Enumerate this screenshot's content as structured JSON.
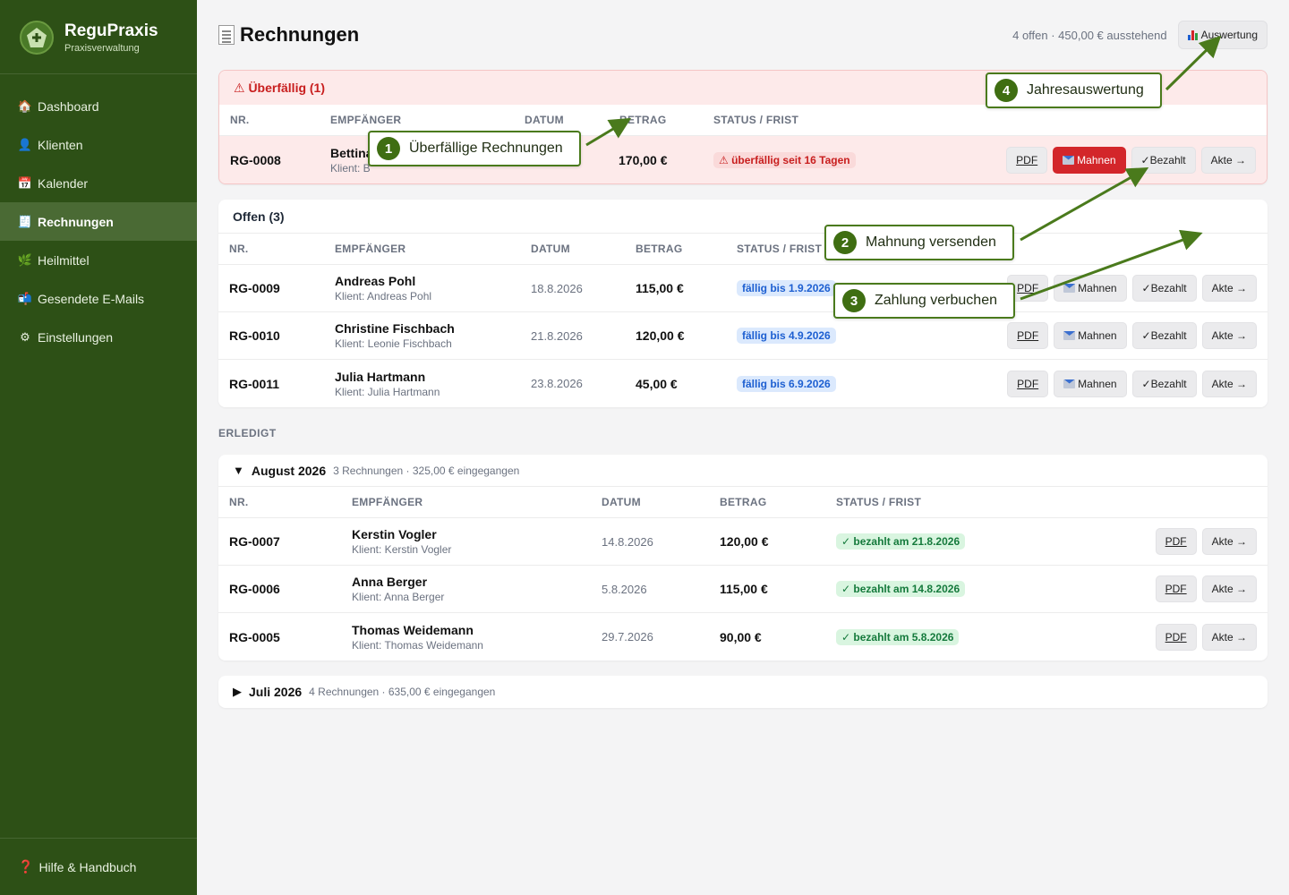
{
  "brand": {
    "title": "ReguPraxis",
    "subtitle": "Praxisverwaltung"
  },
  "sidebar": {
    "items": [
      {
        "label": "Dashboard",
        "icon": "house-icon"
      },
      {
        "label": "Klienten",
        "icon": "person-icon"
      },
      {
        "label": "Kalender",
        "icon": "calendar-icon"
      },
      {
        "label": "Rechnungen",
        "icon": "receipt-icon",
        "active": true
      },
      {
        "label": "Heilmittel",
        "icon": "herb-icon"
      },
      {
        "label": "Gesendete E-Mails",
        "icon": "mailbox-icon"
      },
      {
        "label": "Einstellungen",
        "icon": "gear-icon"
      }
    ],
    "footer": "Hilfe & Handbuch"
  },
  "header": {
    "title": "Rechnungen",
    "summary": "4 offen · 450,00 € ausstehend",
    "eval_button": "Auswertung"
  },
  "columns": {
    "nr": "NR.",
    "recipient": "EMPFÄNGER",
    "date": "DATUM",
    "amount": "BETRAG",
    "status": "STATUS / FRIST"
  },
  "buttons": {
    "pdf": "PDF",
    "remind": "Mahnen",
    "paid": "✓Bezahlt",
    "file": "Akte →"
  },
  "overdue": {
    "title": "⚠ Überfällig (1)",
    "rows": [
      {
        "nr": "RG-0008",
        "name": "Bettina",
        "client": "Klient: B",
        "date": "",
        "amount": "170,00 €",
        "status": "⚠ überfällig seit 16 Tagen"
      }
    ]
  },
  "open": {
    "title": "Offen (3)",
    "rows": [
      {
        "nr": "RG-0009",
        "name": "Andreas Pohl",
        "client": "Klient: Andreas Pohl",
        "date": "18.8.2026",
        "amount": "115,00 €",
        "status": "fällig bis 1.9.2026"
      },
      {
        "nr": "RG-0010",
        "name": "Christine Fischbach",
        "client": "Klient: Leonie Fischbach",
        "date": "21.8.2026",
        "amount": "120,00 €",
        "status": "fällig bis 4.9.2026"
      },
      {
        "nr": "RG-0011",
        "name": "Julia Hartmann",
        "client": "Klient: Julia Hartmann",
        "date": "23.8.2026",
        "amount": "45,00 €",
        "status": "fällig bis 6.9.2026"
      }
    ]
  },
  "done": {
    "label": "ERLEDIGT",
    "groups": [
      {
        "toggle": "▼",
        "title": "August 2026",
        "meta": "3 Rechnungen · 325,00 € eingegangen",
        "rows": [
          {
            "nr": "RG-0007",
            "name": "Kerstin Vogler",
            "client": "Klient: Kerstin Vogler",
            "date": "14.8.2026",
            "amount": "120,00 €",
            "status": "✓ bezahlt am 21.8.2026"
          },
          {
            "nr": "RG-0006",
            "name": "Anna Berger",
            "client": "Klient: Anna Berger",
            "date": "5.8.2026",
            "amount": "115,00 €",
            "status": "✓ bezahlt am 14.8.2026"
          },
          {
            "nr": "RG-0005",
            "name": "Thomas Weidemann",
            "client": "Klient: Thomas Weidemann",
            "date": "29.7.2026",
            "amount": "90,00 €",
            "status": "✓ bezahlt am 5.8.2026"
          }
        ]
      },
      {
        "toggle": "▶",
        "title": "Juli 2026",
        "meta": "4 Rechnungen · 635,00 € eingegangen"
      }
    ]
  },
  "callouts": [
    {
      "num": "1",
      "text": "Überfällige Rechnungen"
    },
    {
      "num": "2",
      "text": "Mahnung versenden"
    },
    {
      "num": "3",
      "text": "Zahlung verbuchen"
    },
    {
      "num": "4",
      "text": "Jahresauswertung"
    }
  ],
  "colors": {
    "sidebar": "#2d5016",
    "accent": "#3f6e12",
    "danger": "#d3262a"
  }
}
